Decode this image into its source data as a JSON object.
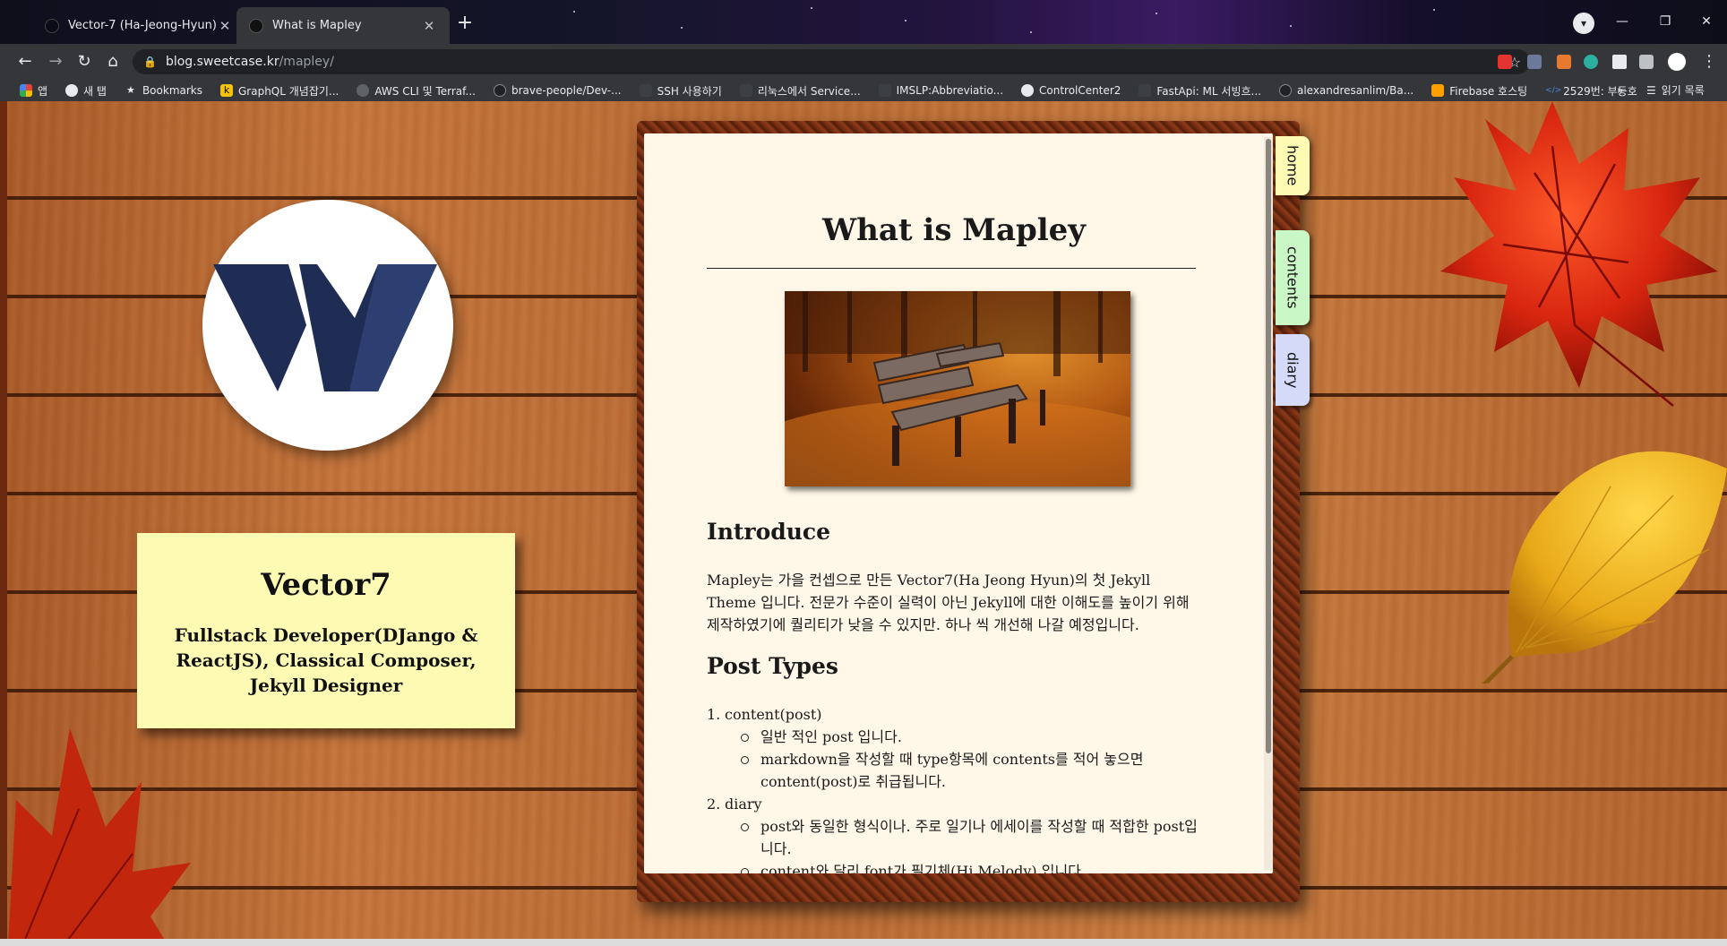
{
  "browser": {
    "tabs": [
      {
        "title": "Vector-7 (Ha-Jeong-Hyun)",
        "active": false
      },
      {
        "title": "What is Mapley",
        "active": true
      }
    ],
    "address": {
      "host": "blog.sweetcase.kr",
      "path": "/mapley/"
    },
    "bookmarks": [
      {
        "label": "앱",
        "icon": "apps-grid-icon"
      },
      {
        "label": "새 탭",
        "icon": "globe-icon"
      },
      {
        "label": "Bookmarks",
        "icon": "star-icon"
      },
      {
        "label": "GraphQL 개념잡기...",
        "icon": "k-icon"
      },
      {
        "label": "AWS CLI 및 Terraf...",
        "icon": "globe-icon"
      },
      {
        "label": "brave-people/Dev-...",
        "icon": "github-icon"
      },
      {
        "label": "SSH 사용하기",
        "icon": "page-icon"
      },
      {
        "label": "리눅스에서 Service...",
        "icon": "page-icon"
      },
      {
        "label": "IMSLP:Abbreviatio...",
        "icon": "page-icon"
      },
      {
        "label": "ControlCenter2",
        "icon": "globe-icon"
      },
      {
        "label": "FastApi: ML 서빙흐...",
        "icon": "page-icon"
      },
      {
        "label": "alexandresanlim/Ba...",
        "icon": "github-icon"
      },
      {
        "label": "Firebase 호스팅",
        "icon": "firebase-icon"
      },
      {
        "label": "2529번: 부등호",
        "icon": "code-icon"
      }
    ],
    "more_label": "»",
    "reading_list_label": "읽기 목록"
  },
  "page": {
    "profile": {
      "name": "Vector7",
      "description": "Fullstack Developer(DJango & ReactJS), Classical Composer, Jekyll Designer"
    },
    "nav_tabs": [
      "home",
      "contents",
      "diary"
    ],
    "post": {
      "title": "What is Mapley",
      "intro_heading": "Introduce",
      "intro_body": "Mapley는 가을 컨셉으로 만든 Vector7(Ha Jeong Hyun)의 첫 Jekyll Theme 입니다. 전문가 수준이 실력이 아닌 Jekyll에 대한 이해도를 높이기 위해 제작하였기에 퀄리티가 낮을 수 있지만. 하나 씩 개선해 나갈 예정입니다.",
      "types_heading": "Post Types",
      "types": [
        {
          "number": "1.",
          "label": "content(post)",
          "items": [
            "일반 적인 post 입니다.",
            "markdown을 작성할 때 type항목에 contents를 적어 놓으면 content(post)로 취급됩니다."
          ]
        },
        {
          "number": "2.",
          "label": "diary",
          "items": [
            "post와 동일한 형식이나. 주로 일기나 에세이를 작성할 때 적합한 post입니다.",
            "content와 달리 font가 필기체(Hi Melody) 입니다."
          ]
        }
      ]
    }
  },
  "colors": {
    "card_yellow": "#fcfab3",
    "tab_home": "#fcfab3",
    "tab_contents": "#c9f7c6",
    "tab_diary": "#d4daf7",
    "paper": "#fff8e9",
    "logo_navy": "#1f2d55"
  }
}
